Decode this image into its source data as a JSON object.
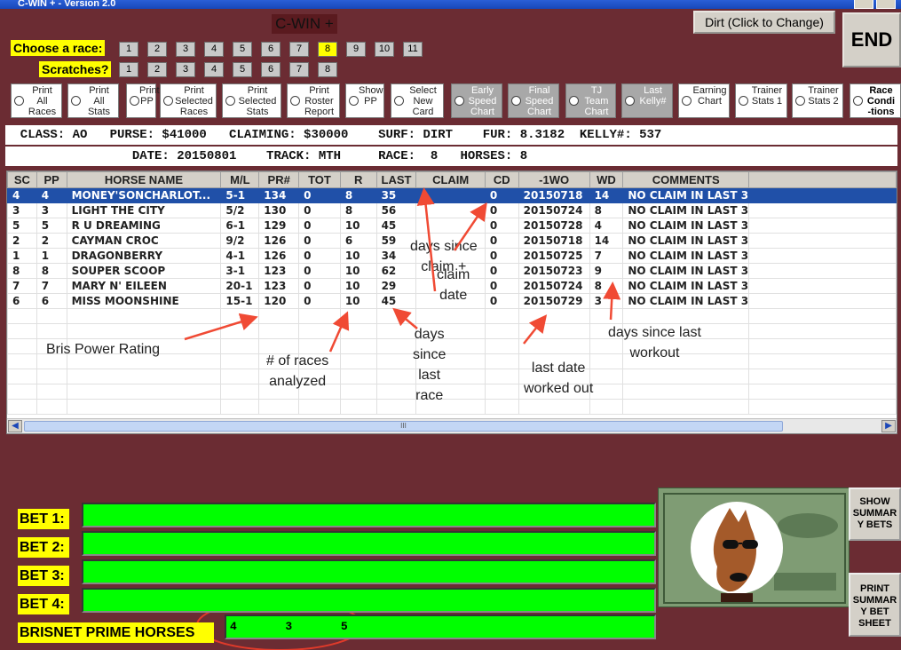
{
  "window": {
    "title": "C-WIN + - Version 2.0"
  },
  "app_title": "C-WIN +",
  "choose_race": {
    "label": "Choose  a race:",
    "races": [
      "1",
      "2",
      "3",
      "4",
      "5",
      "6",
      "7",
      "8",
      "9",
      "10",
      "11"
    ],
    "selected": "8"
  },
  "scratches": {
    "label": "Scratches?",
    "numbers": [
      "1",
      "2",
      "3",
      "4",
      "5",
      "6",
      "7",
      "8"
    ]
  },
  "buttons": {
    "dirt": "Dirt (Click to Change)",
    "end": "END"
  },
  "options": [
    "Print\nAll\nRaces",
    "Print\nAll\nStats",
    "Print\nPP",
    "Print\nSelected\nRaces",
    "Print\nSelected\nStats",
    "Print\nRoster\nReport",
    "Show\nPP",
    "Select\nNew\nCard",
    "Early\nSpeed\nChart",
    "Final\nSpeed\nChart",
    "TJ\nTeam\nChart",
    "Last\nKelly#",
    "Earning\nChart",
    "Trainer\nStats 1",
    "Trainer\nStats 2",
    "Race\nCondi\n-tions"
  ],
  "info": {
    "line1": "  CLASS: AO   PURSE: $41000   CLAIMING: $30000    SURF: DIRT    FUR: 8.3182  KELLY#: 537",
    "line2": "                 DATE: 20150801    TRACK: MTH     RACE:  8   HORSES: 8"
  },
  "table": {
    "columns": [
      "SC",
      "PP",
      "HORSE NAME",
      "M/L",
      "PR#",
      "TOT",
      "R",
      "LAST",
      "CLAIM",
      "CD",
      "-1WO",
      "WD",
      "COMMENTS"
    ],
    "rows": [
      [
        "4",
        "4",
        "MONEY'SONCHARLOT...",
        "5-1",
        "134",
        "0",
        "8",
        "35",
        "",
        "0",
        "20150718",
        "14",
        "NO CLAIM IN LAST 3"
      ],
      [
        "3",
        "3",
        "LIGHT THE CITY",
        "5/2",
        "130",
        "0",
        "8",
        "56",
        "",
        "0",
        "20150724",
        "8",
        "NO CLAIM IN LAST 3"
      ],
      [
        "5",
        "5",
        "R U DREAMING",
        "6-1",
        "129",
        "0",
        "10",
        "45",
        "",
        "0",
        "20150728",
        "4",
        "NO CLAIM IN LAST 3"
      ],
      [
        "2",
        "2",
        "CAYMAN CROC",
        "9/2",
        "126",
        "0",
        "6",
        "59",
        "",
        "0",
        "20150718",
        "14",
        "NO CLAIM IN LAST 3"
      ],
      [
        "1",
        "1",
        "DRAGONBERRY",
        "4-1",
        "126",
        "0",
        "10",
        "34",
        "",
        "0",
        "20150725",
        "7",
        "NO CLAIM IN LAST 3"
      ],
      [
        "8",
        "8",
        "SOUPER SCOOP",
        "3-1",
        "123",
        "0",
        "10",
        "62",
        "",
        "0",
        "20150723",
        "9",
        "NO CLAIM IN LAST 3"
      ],
      [
        "7",
        "7",
        "MARY N' EILEEN",
        "20-1",
        "123",
        "0",
        "10",
        "29",
        "",
        "0",
        "20150724",
        "8",
        "NO CLAIM IN LAST 3"
      ],
      [
        "6",
        "6",
        "MISS MOONSHINE",
        "15-1",
        "120",
        "0",
        "10",
        "45",
        "",
        "0",
        "20150729",
        "3",
        "NO CLAIM IN LAST 3"
      ]
    ],
    "selected_row": 0,
    "scroll_glyph": "III"
  },
  "annotations": {
    "bris": "Bris Power Rating",
    "races_analyzed": "# of races\nanalyzed",
    "days_since_last_race": "days\nsince\nlast\nrace",
    "days_since_claim": "days since\nclaim +",
    "claim_date": "claim\ndate",
    "last_date_worked": "last date\nworked out",
    "days_since_workout": "days since last\nworkout"
  },
  "bets": {
    "labels": [
      "BET 1:",
      "BET 2:",
      "BET 3:",
      "BET 4:"
    ],
    "values": [
      "",
      "",
      "",
      ""
    ],
    "prime_label": "BRISNET PRIME HORSES",
    "prime_value": "4       3       5"
  },
  "side_buttons": {
    "show": "SHOW\nSUMMAR\nY BETS",
    "print": "PRINT\nSUMMAR\nY BET\nSHEET"
  },
  "colors": {
    "background": "#6b2c33",
    "highlight": "#ffff00",
    "bet_field": "#00ff00",
    "selected_row": "#2050a8",
    "annotation_arrow": "#f04a34"
  }
}
